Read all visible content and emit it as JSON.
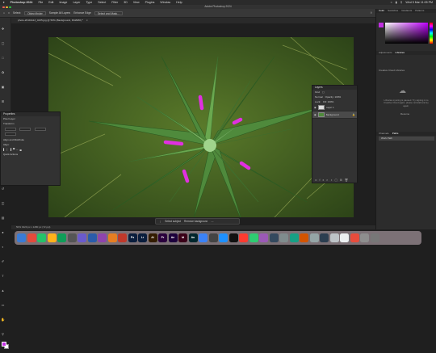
{
  "menubar": {
    "app": "Photoshop 2024",
    "items": [
      "File",
      "Edit",
      "Image",
      "Layer",
      "Type",
      "Select",
      "Filter",
      "3D",
      "View",
      "Plugins",
      "Window",
      "Help"
    ],
    "clock": "Wed 5 Mar 11:05 PM"
  },
  "window": {
    "title": "Adobe Photoshop 2024"
  },
  "options": {
    "select_label": "Select:",
    "select_value": "Object finder",
    "sample_label": "Sample All Layers",
    "enhance_label": "Enhance Edge",
    "sam_label": "Hardness",
    "refine": "Select and Mask..."
  },
  "doc_tab": "photo-20191113_0435.jpg @ 50% (Background, RGB/8#) *",
  "taskbar": {
    "select_subject": "Select subject",
    "remove_bg": "Remove background"
  },
  "status": "50%   1920 px x 1280 px (72 ppi)",
  "properties": {
    "title": "Properties",
    "pixel_layer": "Pixel Layer",
    "transform": "Transform",
    "align": "Align and Distribute",
    "align_sub": "Align:",
    "quick_actions": "Quick Actions"
  },
  "layers": {
    "title": "Layers",
    "kind": "Kind",
    "mode": "Normal",
    "opacity": "Opacity: 100%",
    "lock": "Lock:",
    "fill": "Fill: 100%",
    "rows": [
      {
        "name": "Layer 1"
      },
      {
        "name": "Background"
      }
    ]
  },
  "right": {
    "tabs": [
      "Color",
      "Swatches",
      "Gradients",
      "Patterns"
    ],
    "tabs2": [
      "Adjustments",
      "Libraries"
    ],
    "libraries_title": "Libraries",
    "lib_msg": "Creative Cloud Libraries",
    "lib_note": "Libraries syncing is paused. Try signing in to Creative Cloud again, please reinstall and try again.",
    "resume": "Resume",
    "tabs3": [
      "Channels",
      "Paths"
    ],
    "chan_row": "Work Path"
  },
  "dock_icons": [
    {
      "label": "",
      "color": "#3a7bd5"
    },
    {
      "label": "",
      "color": "#e34b3b"
    },
    {
      "label": "",
      "color": "#25c26a"
    },
    {
      "label": "",
      "color": "#ffb11b"
    },
    {
      "label": "",
      "color": "#0f9d58"
    },
    {
      "label": "",
      "color": "#555"
    },
    {
      "label": "",
      "color": "#6a5acd"
    },
    {
      "label": "",
      "color": "#2a5caa"
    },
    {
      "label": "",
      "color": "#8e44ad"
    },
    {
      "label": "",
      "color": "#e67e22"
    },
    {
      "label": "",
      "color": "#c0392b"
    },
    {
      "label": "Ps",
      "color": "#0a1d3c"
    },
    {
      "label": "Lr",
      "color": "#0a1d3c"
    },
    {
      "label": "Ai",
      "color": "#331c00"
    },
    {
      "label": "Pr",
      "color": "#2a003c"
    },
    {
      "label": "Ae",
      "color": "#1d003c"
    },
    {
      "label": "Id",
      "color": "#3a0018"
    },
    {
      "label": "Au",
      "color": "#00262c"
    },
    {
      "label": "",
      "color": "#3b82f6"
    },
    {
      "label": "",
      "color": "#444"
    },
    {
      "label": "",
      "color": "#1e90ff"
    },
    {
      "label": "",
      "color": "#111"
    },
    {
      "label": "",
      "color": "#ff3b30"
    },
    {
      "label": "",
      "color": "#2ecc71"
    },
    {
      "label": "",
      "color": "#9b59b6"
    },
    {
      "label": "",
      "color": "#34495e"
    },
    {
      "label": "",
      "color": "#7f8c8d"
    },
    {
      "label": "",
      "color": "#16a085"
    },
    {
      "label": "",
      "color": "#d35400"
    },
    {
      "label": "",
      "color": "#95a5a6"
    },
    {
      "label": "",
      "color": "#2c3e50"
    },
    {
      "label": "",
      "color": "#bdc3c7"
    },
    {
      "label": "",
      "color": "#ecf0f1"
    },
    {
      "label": "",
      "color": "#e74c3c"
    },
    {
      "label": "",
      "color": "#8e8e8e"
    },
    {
      "label": "",
      "color": "#777"
    }
  ],
  "accent": "#c02fe0"
}
